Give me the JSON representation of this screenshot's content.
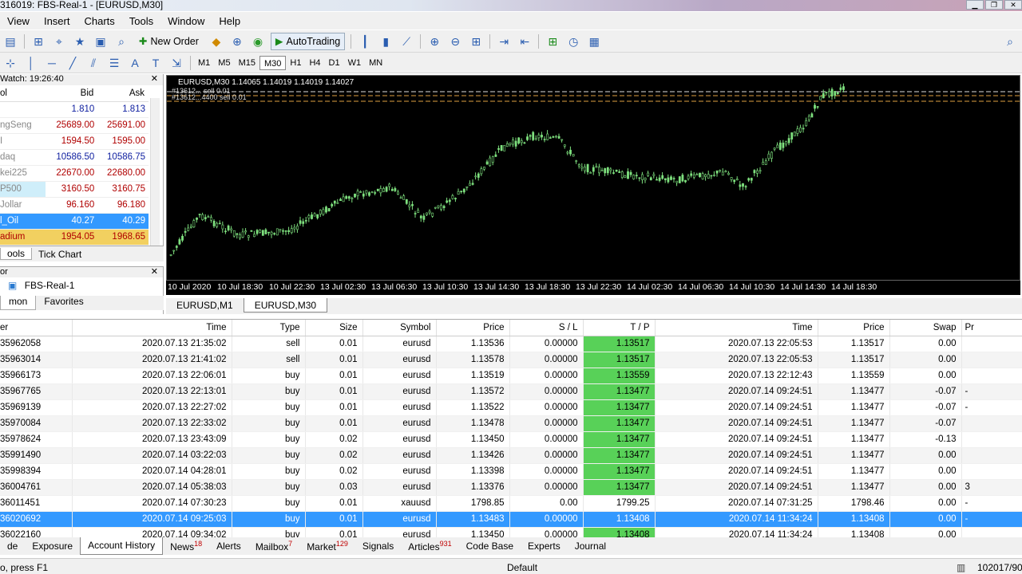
{
  "window": {
    "title": "316019: FBS-Real-1 - [EURUSD,M30]",
    "buttons": [
      "▁",
      "❐",
      "✕"
    ]
  },
  "menu": [
    "View",
    "Insert",
    "Charts",
    "Tools",
    "Window",
    "Help"
  ],
  "toolbar": {
    "new_order": "New Order",
    "autotrading": "AutoTrading"
  },
  "timeframes": [
    "M1",
    "M5",
    "M15",
    "M30",
    "H1",
    "H4",
    "D1",
    "W1",
    "MN"
  ],
  "active_timeframe": "M30",
  "market_watch": {
    "title": "Watch: 19:26:40",
    "col_symbol": "ol",
    "col_bid": "Bid",
    "col_ask": "Ask",
    "rows": [
      {
        "symbol": "",
        "bid": "1.810",
        "ask": "1.813",
        "color": "blue"
      },
      {
        "symbol": "ngSeng",
        "bid": "25689.00",
        "ask": "25691.00",
        "color": "red"
      },
      {
        "symbol": "I",
        "bid": "1594.50",
        "ask": "1595.00",
        "color": "red"
      },
      {
        "symbol": "daq",
        "bid": "10586.50",
        "ask": "10586.75",
        "color": "blue"
      },
      {
        "symbol": "kei225",
        "bid": "22670.00",
        "ask": "22680.00",
        "color": "red"
      },
      {
        "symbol": "P500",
        "bid": "3160.50",
        "ask": "3160.75",
        "color": "red"
      },
      {
        "symbol": "Jollar",
        "bid": "96.160",
        "ask": "96.180",
        "color": "red"
      },
      {
        "symbol": "l_Oil",
        "bid": "40.27",
        "ask": "40.29",
        "color": "sel"
      },
      {
        "symbol": "adium",
        "bid": "1954.05",
        "ask": "1968.65",
        "color": "yel"
      }
    ],
    "tabs": [
      "ools",
      "Tick Chart"
    ]
  },
  "navigator": {
    "title": "or",
    "account": "FBS-Real-1",
    "tabs": [
      "mon",
      "Favorites"
    ]
  },
  "chart": {
    "info": "EURUSD,M30  1.14065 1.14019 1.14019 1.14027",
    "order_labels": [
      "#13612... sell 0.01",
      "#13612...4400 sell 0.01"
    ],
    "x_labels": [
      "10 Jul 2020",
      "10 Jul 18:30",
      "10 Jul 22:30",
      "13 Jul 02:30",
      "13 Jul 06:30",
      "13 Jul 10:30",
      "13 Jul 14:30",
      "13 Jul 18:30",
      "13 Jul 22:30",
      "14 Jul 02:30",
      "14 Jul 06:30",
      "14 Jul 10:30",
      "14 Jul 14:30",
      "14 Jul 18:30"
    ],
    "tabs": [
      "EURUSD,M1",
      "EURUSD,M30"
    ],
    "active_tab": "EURUSD,M30"
  },
  "terminal": {
    "columns": [
      "er",
      "Time",
      "Type",
      "Size",
      "Symbol",
      "Price",
      "S / L",
      "T / P",
      "Time",
      "Price",
      "Swap",
      "Pr"
    ],
    "rows": [
      [
        "35962058",
        "2020.07.13 21:35:02",
        "sell",
        "0.01",
        "eurusd",
        "1.13536",
        "0.00000",
        "1.13517",
        "2020.07.13 22:05:53",
        "1.13517",
        "0.00",
        ""
      ],
      [
        "35963014",
        "2020.07.13 21:41:02",
        "sell",
        "0.01",
        "eurusd",
        "1.13578",
        "0.00000",
        "1.13517",
        "2020.07.13 22:05:53",
        "1.13517",
        "0.00",
        ""
      ],
      [
        "35966173",
        "2020.07.13 22:06:01",
        "buy",
        "0.01",
        "eurusd",
        "1.13519",
        "0.00000",
        "1.13559",
        "2020.07.13 22:12:43",
        "1.13559",
        "0.00",
        ""
      ],
      [
        "35967765",
        "2020.07.13 22:13:01",
        "buy",
        "0.01",
        "eurusd",
        "1.13572",
        "0.00000",
        "1.13477",
        "2020.07.14 09:24:51",
        "1.13477",
        "-0.07",
        "-"
      ],
      [
        "35969139",
        "2020.07.13 22:27:02",
        "buy",
        "0.01",
        "eurusd",
        "1.13522",
        "0.00000",
        "1.13477",
        "2020.07.14 09:24:51",
        "1.13477",
        "-0.07",
        "-"
      ],
      [
        "35970084",
        "2020.07.13 22:33:02",
        "buy",
        "0.01",
        "eurusd",
        "1.13478",
        "0.00000",
        "1.13477",
        "2020.07.14 09:24:51",
        "1.13477",
        "-0.07",
        ""
      ],
      [
        "35978624",
        "2020.07.13 23:43:09",
        "buy",
        "0.02",
        "eurusd",
        "1.13450",
        "0.00000",
        "1.13477",
        "2020.07.14 09:24:51",
        "1.13477",
        "-0.13",
        ""
      ],
      [
        "35991490",
        "2020.07.14 03:22:03",
        "buy",
        "0.02",
        "eurusd",
        "1.13426",
        "0.00000",
        "1.13477",
        "2020.07.14 09:24:51",
        "1.13477",
        "0.00",
        ""
      ],
      [
        "35998394",
        "2020.07.14 04:28:01",
        "buy",
        "0.02",
        "eurusd",
        "1.13398",
        "0.00000",
        "1.13477",
        "2020.07.14 09:24:51",
        "1.13477",
        "0.00",
        ""
      ],
      [
        "36004761",
        "2020.07.14 05:38:03",
        "buy",
        "0.03",
        "eurusd",
        "1.13376",
        "0.00000",
        "1.13477",
        "2020.07.14 09:24:51",
        "1.13477",
        "0.00",
        "3"
      ],
      [
        "36011451",
        "2020.07.14 07:30:23",
        "buy",
        "0.01",
        "xauusd",
        "1798.85",
        "0.00",
        "1799.25",
        "2020.07.14 07:31:25",
        "1798.46",
        "0.00",
        "-"
      ],
      [
        "36020692",
        "2020.07.14 09:25:03",
        "buy",
        "0.01",
        "eurusd",
        "1.13483",
        "0.00000",
        "1.13408",
        "2020.07.14 11:34:24",
        "1.13408",
        "0.00",
        "-"
      ],
      [
        "36022160",
        "2020.07.14 09:34:02",
        "buy",
        "0.01",
        "eurusd",
        "1.13450",
        "0.00000",
        "1.13408",
        "2020.07.14 11:34:24",
        "1.13408",
        "0.00",
        ""
      ]
    ],
    "tabs": [
      {
        "label": "de",
        "badge": ""
      },
      {
        "label": "Exposure",
        "badge": ""
      },
      {
        "label": "Account History",
        "badge": ""
      },
      {
        "label": "News",
        "badge": "18"
      },
      {
        "label": "Alerts",
        "badge": ""
      },
      {
        "label": "Mailbox",
        "badge": "7"
      },
      {
        "label": "Market",
        "badge": "129"
      },
      {
        "label": "Signals",
        "badge": ""
      },
      {
        "label": "Articles",
        "badge": "931"
      },
      {
        "label": "Code Base",
        "badge": ""
      },
      {
        "label": "Experts",
        "badge": ""
      },
      {
        "label": "Journal",
        "badge": ""
      }
    ],
    "active_tab": "Account History"
  },
  "status": {
    "help": "o, press F1",
    "profile": "Default",
    "traffic": "102017/90"
  },
  "colors": {
    "bull": "#7ee07e",
    "tp_green": "#58d158",
    "selection": "#3399ff"
  }
}
